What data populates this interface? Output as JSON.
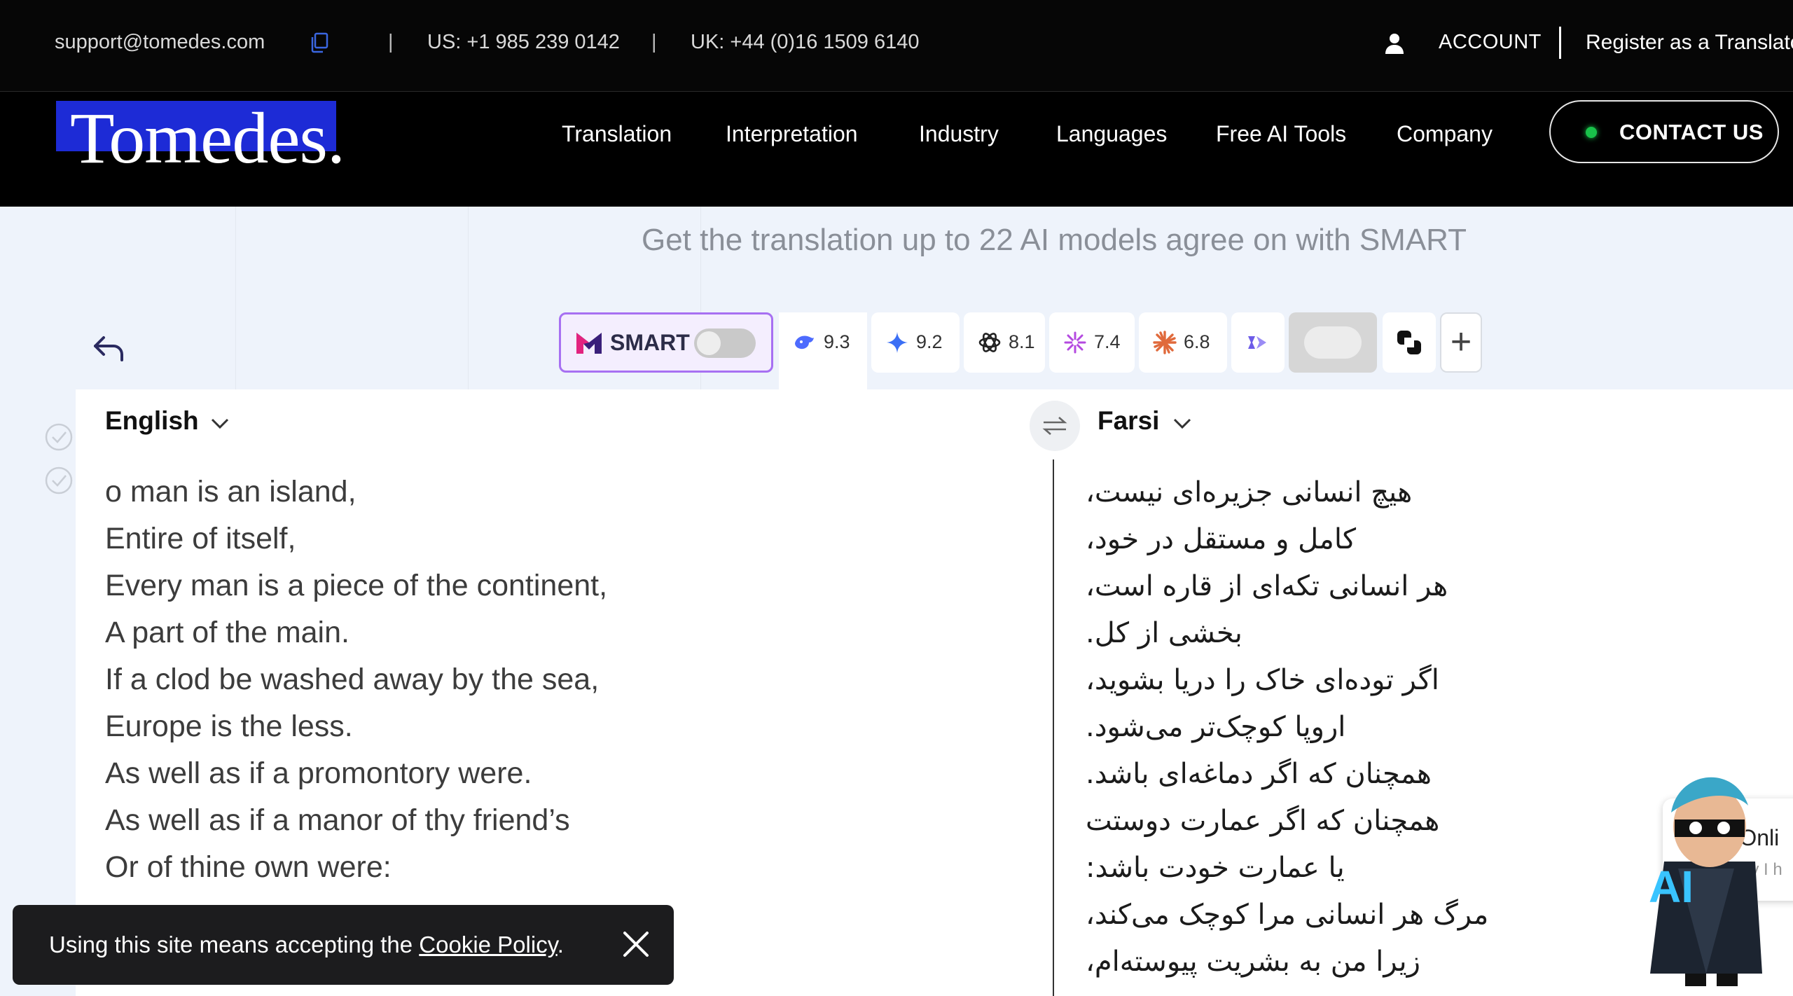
{
  "topbar": {
    "email": "support@tomedes.com",
    "separator": "|",
    "phone_us": "US: +1 985 239 0142",
    "phone_uk": "UK: +44 (0)16 1509 6140",
    "account": "ACCOUNT",
    "register": "Register as a Translator"
  },
  "nav": {
    "logo": "Tomedes.",
    "items": [
      "Translation",
      "Interpretation",
      "Industry",
      "Languages",
      "Free AI Tools",
      "Company"
    ],
    "contact": "CONTACT US"
  },
  "banner": "Get the translation up to 22 AI models agree on with SMART",
  "toolbar": {
    "smart_label": "SMART",
    "models": [
      {
        "icon": "deepseek-whale-icon",
        "score": "9.3",
        "color": "#4d6bfe"
      },
      {
        "icon": "gemini-sparkle-icon",
        "score": "9.2",
        "color": "#3b6ff5"
      },
      {
        "icon": "openai-knot-icon",
        "score": "8.1",
        "color": "#222222"
      },
      {
        "icon": "pinwheel-star-icon",
        "score": "7.4",
        "color": "#b44ae0"
      },
      {
        "icon": "claude-burst-icon",
        "score": "6.8",
        "color": "#e06a3c"
      },
      {
        "icon": "mistral-flag-icon",
        "score": "",
        "color": "#6d5ce8"
      }
    ],
    "add_label": "+"
  },
  "source": {
    "language": "English",
    "lines": [
      "o man is an island,",
      "Entire of itself,",
      "Every man is a piece of the continent,",
      "A part of the main.",
      "If a clod be washed away by the sea,",
      "Europe is the less.",
      "As well as if a promontory were.",
      "As well as if a manor of thy friend’s",
      "Or of thine own were:"
    ]
  },
  "target": {
    "language": "Farsi",
    "lines": [
      "هیچ انسانی جزیره‌ای نیست،",
      "کامل و مستقل در خود،",
      "هر انسانی تکه‌ای از قاره است،",
      "بخشی از کل.",
      "اگر توده‌ای خاک را دریا بشوید،",
      "اروپا کوچک‌تر می‌شود.",
      "همچنان که اگر دماغه‌ای باشد.",
      "همچنان که اگر عمارت دوستت",
      "یا عمارت خودت باشد:",
      "مرگ هر انسانی مرا کوچک می‌کند،",
      "زیرا من به بشریت پیوسته‌ام،"
    ]
  },
  "cookie": {
    "text": "Using this site means accepting the ",
    "link": "Cookie Policy",
    "period": "."
  },
  "chat": {
    "line1": "re Onli",
    "line2": "may I h",
    "badge": "AI"
  },
  "colors": {
    "brand_blue": "#1d2bd6",
    "smart_border": "#a770f2",
    "status_green": "#19c24a"
  }
}
